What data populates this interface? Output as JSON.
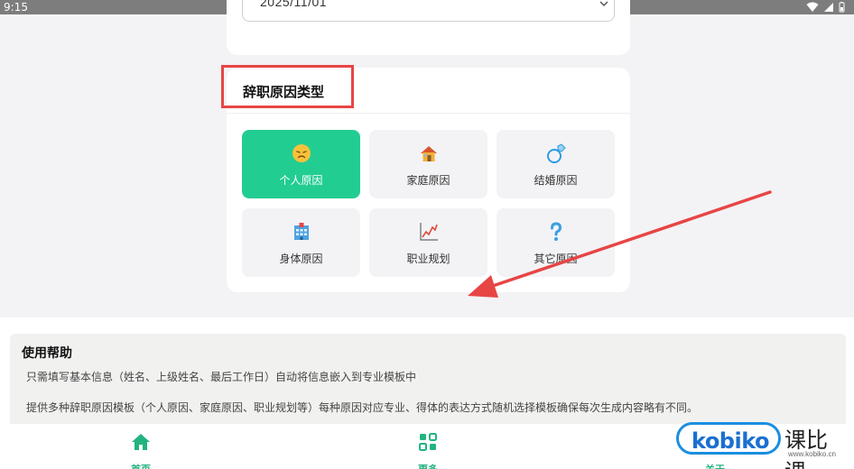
{
  "status_bar": {
    "time": "9:15"
  },
  "date_card": {
    "value": "2025/11/01"
  },
  "reason_card": {
    "title": "辞职原因类型",
    "options": [
      {
        "label": "个人原因",
        "icon": "weary-face-icon",
        "active": true
      },
      {
        "label": "家庭原因",
        "icon": "house-icon",
        "active": false
      },
      {
        "label": "结婚原因",
        "icon": "ring-icon",
        "active": false
      },
      {
        "label": "身体原因",
        "icon": "hospital-icon",
        "active": false
      },
      {
        "label": "职业规划",
        "icon": "chart-increasing-icon",
        "active": false
      },
      {
        "label": "其它原因",
        "icon": "question-mark-icon",
        "active": false
      }
    ]
  },
  "help": {
    "title": "使用帮助",
    "line1": "只需填写基本信息（姓名、上级姓名、最后工作日）自动将信息嵌入到专业模板中",
    "line2": "提供多种辞职原因模板（个人原因、家庭原因、职业规划等）每种原因对应专业、得体的表达方式随机选择模板确保每次生成内容略有不同。"
  },
  "tabbar": {
    "tabs": [
      {
        "label": "首页",
        "icon": "home-icon"
      },
      {
        "label": "更多",
        "icon": "apps-icon"
      },
      {
        "label": "关于",
        "icon": "info-icon"
      }
    ]
  },
  "watermark": {
    "brand": "kobiko",
    "cn": "课比课",
    "url": "www.kobiko.cn"
  },
  "colors": {
    "accent": "#22cd92",
    "tab": "#22b37f",
    "annotation": "#e84545"
  }
}
